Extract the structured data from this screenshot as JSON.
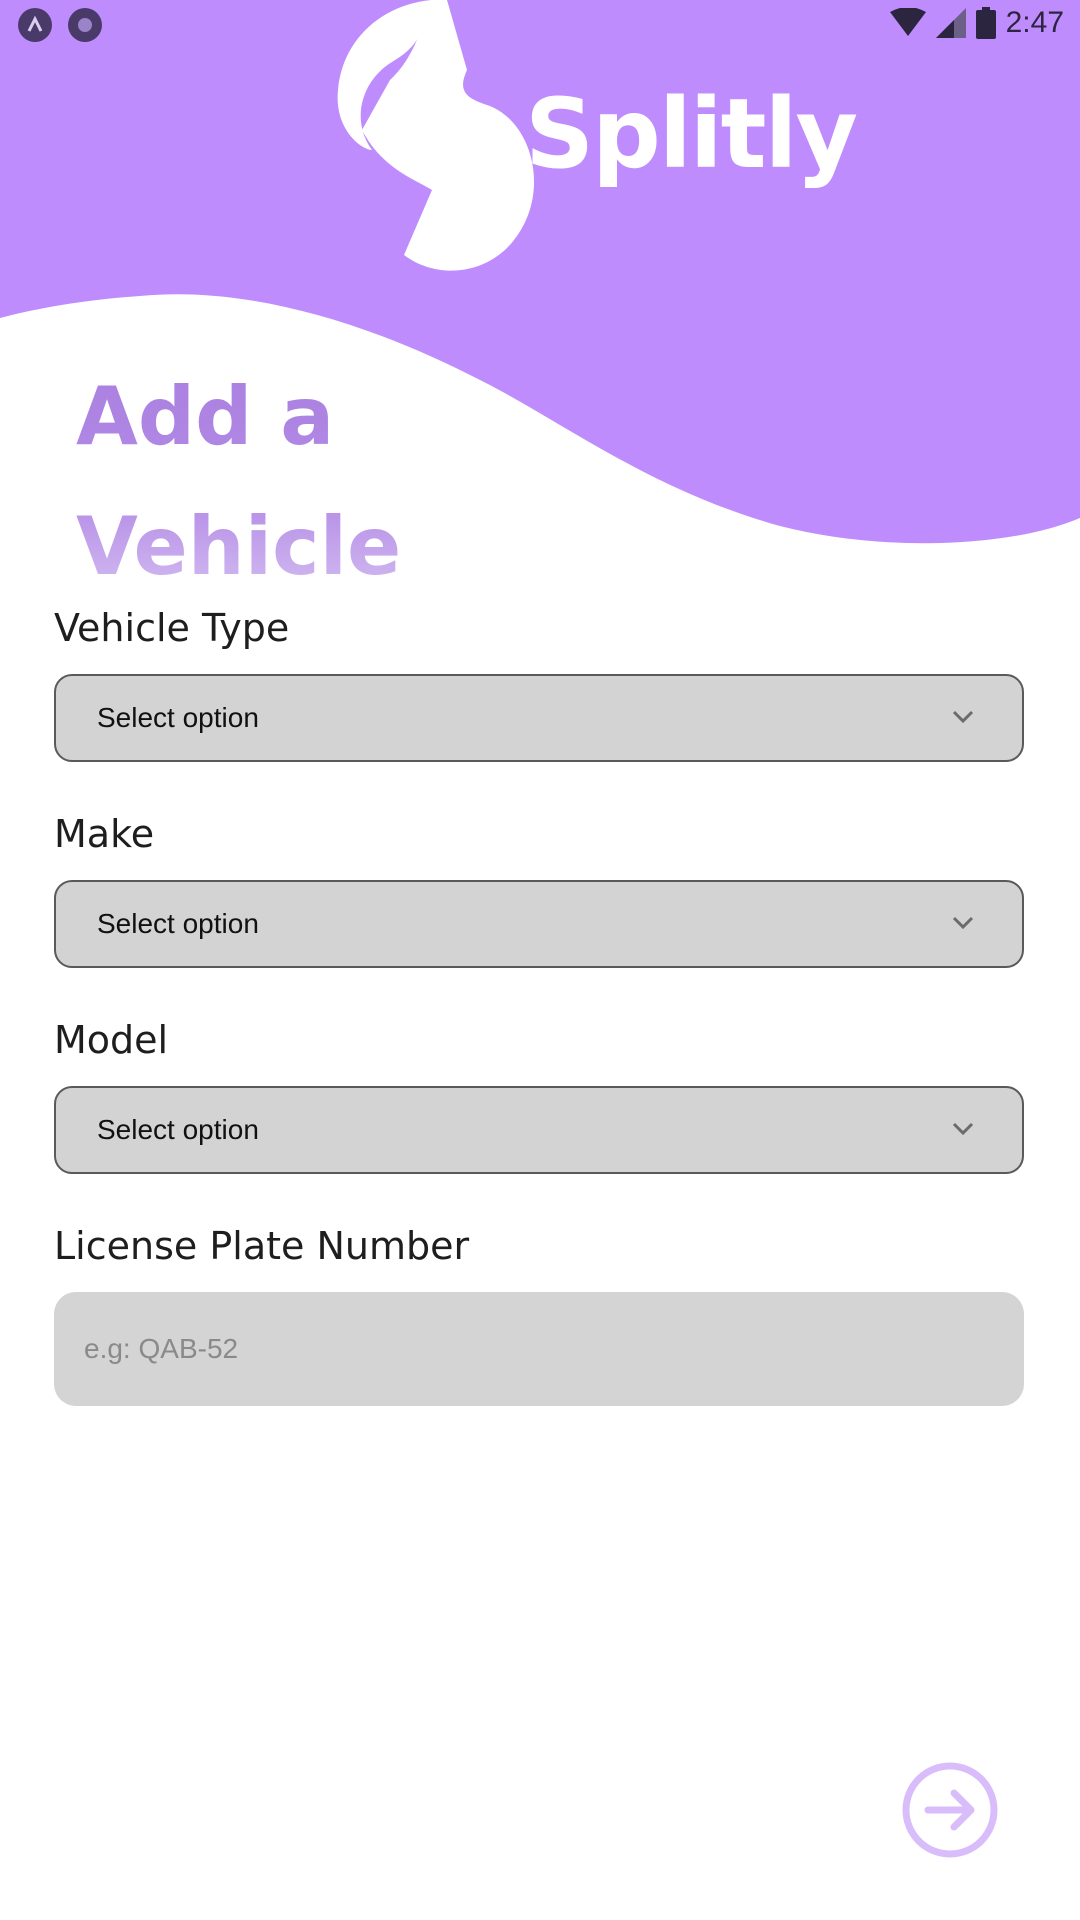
{
  "status_bar": {
    "time": "2:47",
    "icons": [
      "app-indicator-icon",
      "record-icon",
      "wifi-icon",
      "signal-icon",
      "battery-icon"
    ]
  },
  "brand": {
    "name": "Splitly",
    "accent_color": "#bf8cfd"
  },
  "page": {
    "title_line1": "Add a",
    "title_line2": "Vehicle"
  },
  "form": {
    "vehicle_type": {
      "label": "Vehicle Type",
      "value": "Select option"
    },
    "make": {
      "label": "Make",
      "value": "Select option"
    },
    "model": {
      "label": "Model",
      "value": "Select option"
    },
    "license_plate": {
      "label": "License Plate Number",
      "placeholder": "e.g: QAB-52",
      "value": ""
    }
  },
  "actions": {
    "next_icon": "arrow-right-circle-icon"
  }
}
